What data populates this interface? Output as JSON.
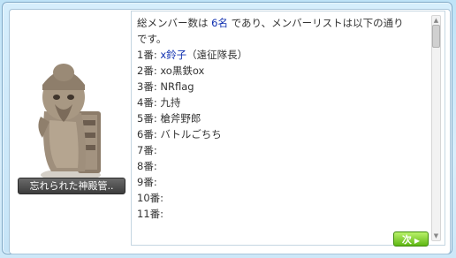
{
  "npc": {
    "name": "忘れられた神殿管.."
  },
  "dialog": {
    "intro_part1": "総メンバー数は ",
    "member_count": "6名",
    "intro_part2": " であり、メンバーリストは以下の通り",
    "intro_line2": "です。",
    "members": [
      {
        "label": "1番:",
        "name": "x鈴子",
        "note": "（遠征隊長）",
        "highlight": true
      },
      {
        "label": "2番:",
        "name": "xo黒鉄ox",
        "note": "",
        "highlight": false
      },
      {
        "label": "3番:",
        "name": "NRflag",
        "note": "",
        "highlight": false
      },
      {
        "label": "4番:",
        "name": "九持",
        "note": "",
        "highlight": false
      },
      {
        "label": "5番:",
        "name": "槍斧野郎",
        "note": "",
        "highlight": false
      },
      {
        "label": "6番:",
        "name": "バトルごちち",
        "note": "",
        "highlight": false
      },
      {
        "label": "7番:",
        "name": "",
        "note": "",
        "highlight": false
      },
      {
        "label": "8番:",
        "name": "",
        "note": "",
        "highlight": false
      },
      {
        "label": "9番:",
        "name": "",
        "note": "",
        "highlight": false
      },
      {
        "label": "10番:",
        "name": "",
        "note": "",
        "highlight": false
      },
      {
        "label": "11番:",
        "name": "",
        "note": "",
        "highlight": false
      }
    ]
  },
  "buttons": {
    "next_label": "次",
    "next_icon": "triangle-right-icon"
  },
  "colors": {
    "member_highlight": "#1030b0",
    "next_button": "#5fb713"
  }
}
